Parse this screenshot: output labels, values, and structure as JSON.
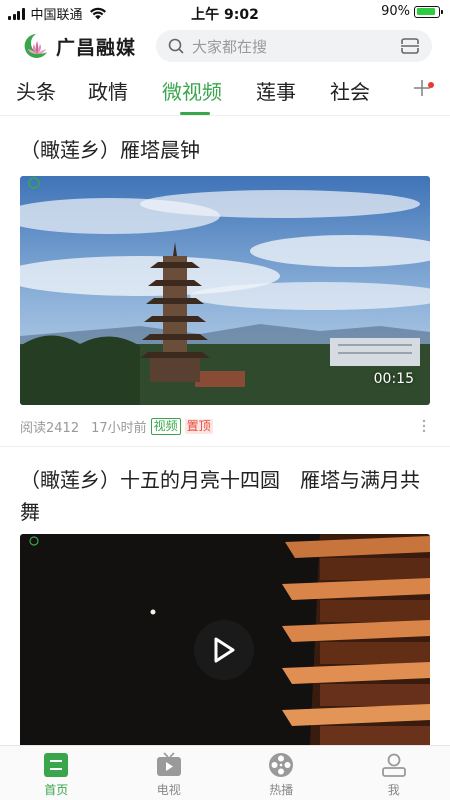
{
  "status_bar": {
    "carrier": "中国联通",
    "time": "上午 9:02",
    "battery_percent": "90%",
    "battery_level": 0.9
  },
  "header": {
    "app_name": "广昌融媒",
    "search_placeholder": "大家都在搜"
  },
  "tabs": [
    {
      "label": "头条",
      "active": false
    },
    {
      "label": "政情",
      "active": false
    },
    {
      "label": "微视频",
      "active": true
    },
    {
      "label": "莲事",
      "active": false
    },
    {
      "label": "社会",
      "active": false
    }
  ],
  "articles": [
    {
      "title": "（瞰莲乡）雁塔晨钟",
      "duration": "00:15",
      "reads": "阅读2412",
      "time": "17小时前",
      "tag_video": "视频",
      "tag_pin": "置顶"
    },
    {
      "title": "（瞰莲乡）十五的月亮十四圆　雁塔与满月共舞"
    }
  ],
  "bottom_nav": [
    {
      "label": "首页",
      "icon": "home-icon",
      "active": true
    },
    {
      "label": "电视",
      "icon": "tv-icon",
      "active": false
    },
    {
      "label": "热播",
      "icon": "film-reel-icon",
      "active": false
    },
    {
      "label": "我",
      "icon": "user-icon",
      "active": false
    }
  ],
  "colors": {
    "accent": "#3aa64b",
    "badge_red": "#e63b2e"
  }
}
